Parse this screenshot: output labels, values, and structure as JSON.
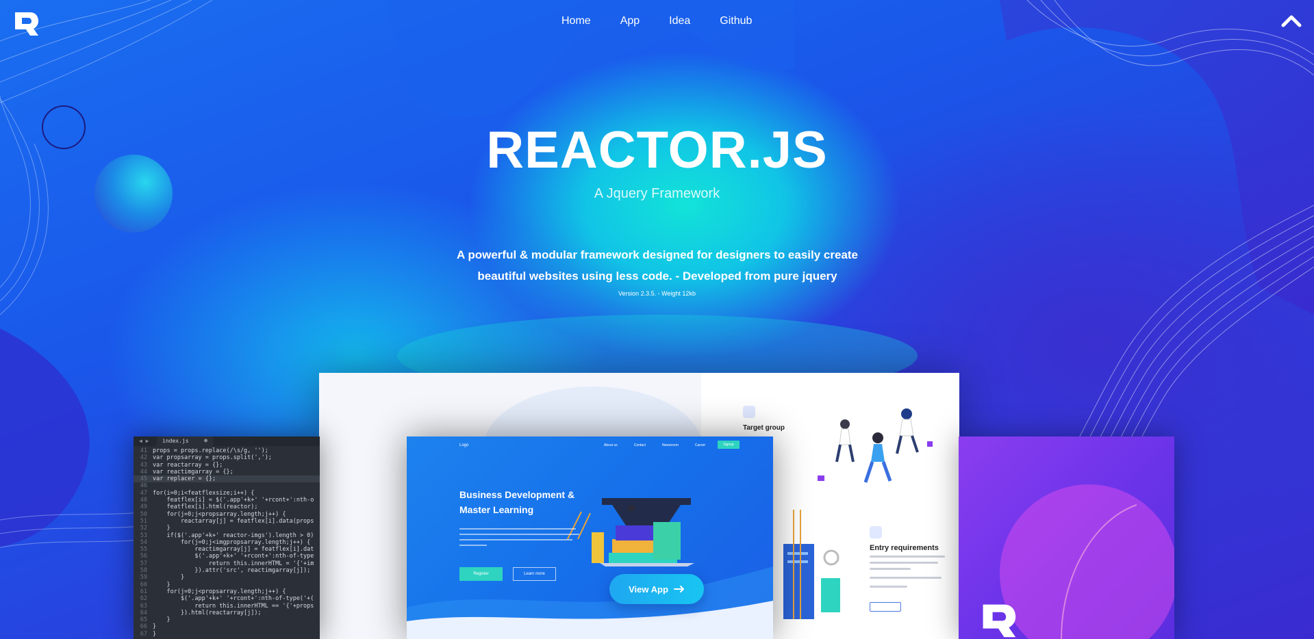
{
  "nav": {
    "items": [
      {
        "label": "Home"
      },
      {
        "label": "App"
      },
      {
        "label": "Idea"
      },
      {
        "label": "Github"
      }
    ]
  },
  "hero": {
    "title": "REACTOR.JS",
    "subtitle": "A Jquery Framework",
    "description_line1": "A powerful & modular framework designed for designers to easily create",
    "description_line2": "beautiful websites using less code. - Developed from pure jquery",
    "version": "Version 2.3.5. - Weight 12kb"
  },
  "cta": {
    "view_app_label": "View App",
    "arrow_icon": "arrow-right-icon"
  },
  "editor": {
    "tab_label": "index.js",
    "lines": [
      {
        "n": "41",
        "code": "props = props.replace(/\\s/g, '');"
      },
      {
        "n": "42",
        "code": "var propsarray = props.split(',');"
      },
      {
        "n": "43",
        "code": "var reactarray = {};"
      },
      {
        "n": "44",
        "code": "var reactimgarray = {};"
      },
      {
        "n": "45",
        "code": "var replacer = {};"
      },
      {
        "n": "46",
        "code": ""
      },
      {
        "n": "47",
        "code": "for(i=0;i<featflexsize;i++) {"
      },
      {
        "n": "48",
        "code": "    featflex[i] = $('.app'+k+' '+rcont+':nth-o"
      },
      {
        "n": "49",
        "code": "    featflex[i].html(reactor);"
      },
      {
        "n": "50",
        "code": "    for(j=0;j<propsarray.length;j++) {"
      },
      {
        "n": "51",
        "code": "        reactarray[j] = featflex[i].data(props"
      },
      {
        "n": "52",
        "code": "    }"
      },
      {
        "n": "53",
        "code": "    if($('.app'+k+' reactor-imgs').length > 0)"
      },
      {
        "n": "54",
        "code": "        for(j=0;j<imgpropsarray.length;j++) {"
      },
      {
        "n": "55",
        "code": "            reactimgarray[j] = featflex[i].dat"
      },
      {
        "n": "56",
        "code": "            $('.app'+k+' '+rcont+':nth-of-type"
      },
      {
        "n": "57",
        "code": "                return this.innerHTML = '{'+im"
      },
      {
        "n": "58",
        "code": "            }).attr('src', reactimgarray[j]);"
      },
      {
        "n": "59",
        "code": "        }"
      },
      {
        "n": "60",
        "code": "    }"
      },
      {
        "n": "61",
        "code": "    for(j=0;j<propsarray.length;j++) {"
      },
      {
        "n": "62",
        "code": "        $('.app'+k+' '+rcont+':nth-of-type('+("
      },
      {
        "n": "63",
        "code": "            return this.innerHTML == '{'+props"
      },
      {
        "n": "64",
        "code": "        }).html(reactarray[j]);"
      },
      {
        "n": "65",
        "code": "    }"
      },
      {
        "n": "66",
        "code": "}"
      },
      {
        "n": "67",
        "code": "}"
      }
    ]
  },
  "mockup": {
    "logo": "Logo",
    "nav": [
      "About us",
      "Contact",
      "Newsroom",
      "Career"
    ],
    "signup": "Signup",
    "headline_line1": "Business Development &",
    "headline_line2": "Master Learning",
    "register": "Register",
    "learn_more": "Learn more",
    "target_group": "Target group",
    "entry_requirements": "Entry requirements"
  },
  "colors": {
    "accent_teal": "#2ed4c0",
    "cta_blue": "#1fa7f0",
    "purple": "#8b3df0"
  }
}
